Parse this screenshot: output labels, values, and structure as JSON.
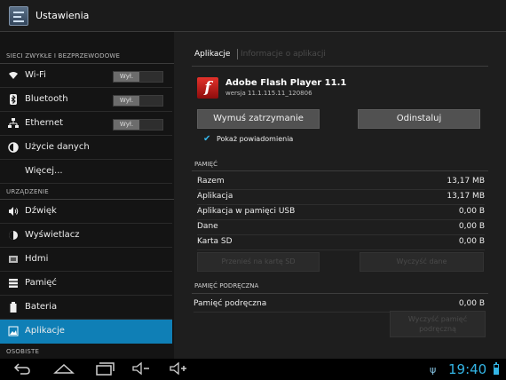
{
  "topbar": {
    "title": "Ustawienia"
  },
  "sidebar": {
    "section_wireless": "SIECI ZWYKŁE I BEZPRZEWODOWE",
    "section_device": "URZĄDZENIE",
    "section_personal": "OSOBISTE",
    "wifi": {
      "label": "Wi-Fi",
      "toggle": "Wył.",
      "icon": "wifi-icon"
    },
    "bluetooth": {
      "label": "Bluetooth",
      "toggle": "Wył.",
      "icon": "bluetooth-icon"
    },
    "ethernet": {
      "label": "Ethernet",
      "toggle": "Wył.",
      "icon": "ethernet-icon"
    },
    "data_usage": {
      "label": "Użycie danych",
      "icon": "data-usage-icon"
    },
    "more": {
      "label": "Więcej..."
    },
    "sound": {
      "label": "Dźwięk",
      "icon": "sound-icon"
    },
    "display": {
      "label": "Wyświetlacz",
      "icon": "display-icon"
    },
    "hdmi": {
      "label": "Hdmi",
      "icon": "hdmi-icon"
    },
    "storage": {
      "label": "Pamięć",
      "icon": "storage-icon"
    },
    "battery": {
      "label": "Bateria",
      "icon": "battery-icon"
    },
    "apps": {
      "label": "Aplikacje",
      "icon": "apps-icon"
    }
  },
  "main": {
    "tab_active": "Aplikacje",
    "tab_inactive": "Informacje o aplikacji",
    "app_name": "Adobe Flash Player 11.1",
    "app_version": "wersja 11.1.115.11_120806",
    "force_stop": "Wymuś zatrzymanie",
    "uninstall": "Odinstaluj",
    "show_notifications": "Pokaż powiadomienia",
    "storage_header": "PAMIĘĆ",
    "storage_rows": [
      {
        "label": "Razem",
        "value": "13,17 MB"
      },
      {
        "label": "Aplikacja",
        "value": "13,17 MB"
      },
      {
        "label": "Aplikacja w pamięci USB",
        "value": "0,00 B"
      },
      {
        "label": "Dane",
        "value": "0,00 B"
      },
      {
        "label": "Karta SD",
        "value": "0,00 B"
      }
    ],
    "move_to_sd": "Przenieś na kartę SD",
    "clear_data": "Wyczyść dane",
    "cache_header": "PAMIĘĆ PODRĘCZNA",
    "cache_row": {
      "label": "Pamięć podręczna",
      "value": "0,00 B"
    },
    "clear_cache_line1": "Wyczyść pamięć",
    "clear_cache_line2": "podręczną"
  },
  "statusbar": {
    "time": "19:40",
    "battery_level": 0.7
  },
  "colors": {
    "accent": "#0f7fb6",
    "clock": "#33b5e5"
  }
}
